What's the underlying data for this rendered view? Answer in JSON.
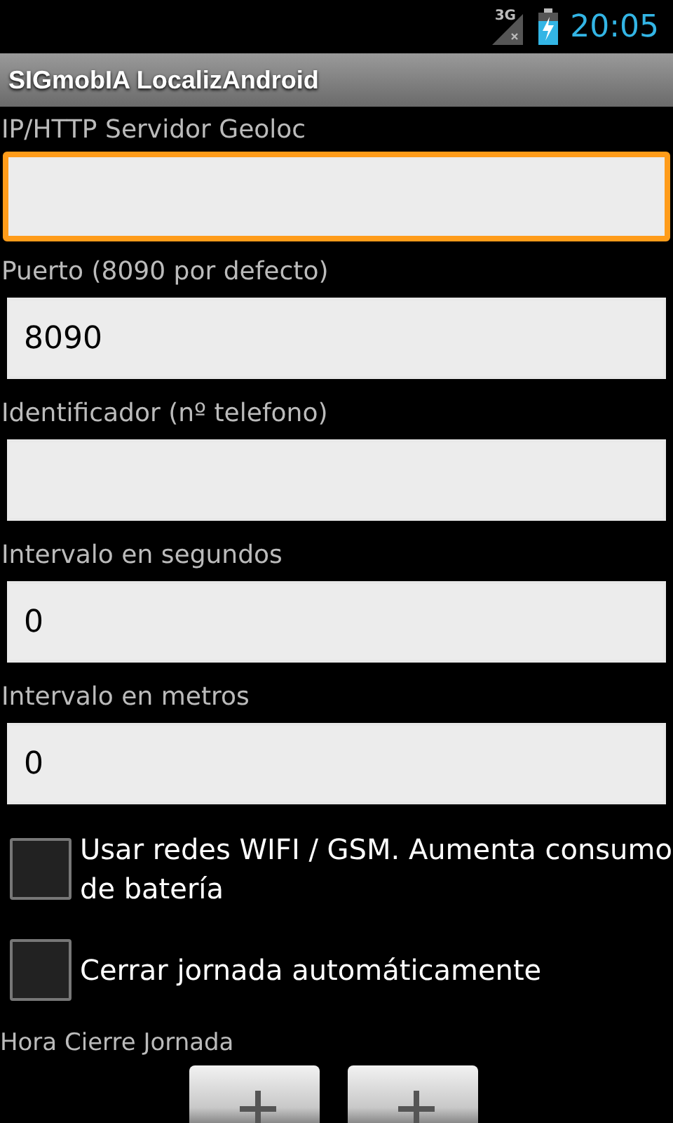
{
  "status_bar": {
    "network": "3G",
    "time": "20:05"
  },
  "title_bar": {
    "title": "SIGmobIA LocalizAndroid"
  },
  "fields": [
    {
      "label": "IP/HTTP Servidor Geoloc",
      "focused": true
    },
    {
      "label": "Puerto (8090 por defecto)",
      "value": "8090",
      "focused": false
    },
    {
      "label": "Identificador (nº telefono)",
      "focused": false
    },
    {
      "label": "Intervalo en segundos",
      "value": "0",
      "focused": false
    },
    {
      "label": "Intervalo en metros",
      "value": "0",
      "focused": false
    }
  ],
  "checkboxes": [
    {
      "label": "Usar redes WIFI / GSM. Aumenta consumo de batería",
      "checked": false
    },
    {
      "label": "Cerrar jornada automáticamente",
      "checked": false
    }
  ],
  "time_picker": {
    "label": "Hora Cierre Jornada"
  }
}
